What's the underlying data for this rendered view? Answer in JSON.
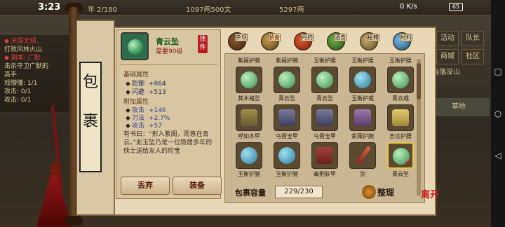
{
  "status_bar": {
    "time": "3:23",
    "net_speed": "0 K/s",
    "battery": "65"
  },
  "top_bar": {
    "date_text": "年 2/180",
    "money_text": "1097两500文",
    "gold_text": "5297两"
  },
  "background_left": {
    "lines": [
      "◆ 天涯无短,",
      "打败风林火山",
      "◆ 副本: 广默",
      "击杀守卫广默的",
      "高手",
      "戏懵懂: 1/1",
      "攻击: 0/1",
      "攻击: 0/1"
    ]
  },
  "background_right": {
    "buttons": [
      "活动",
      "队长",
      "商城",
      "社区"
    ],
    "stage": "洛落深山",
    "land": "草地"
  },
  "side_title": [
    "包",
    "裹"
  ],
  "item_detail": {
    "name": "青云坠",
    "requirement": "需要90级",
    "hang_label": "挂件",
    "base_header": "基础属性",
    "base_attrs": [
      {
        "name": "防御",
        "value": "+864"
      },
      {
        "name": "闪避",
        "value": "+513"
      }
    ],
    "extra_header": "附加属性",
    "extra_attrs": [
      {
        "name": "攻击",
        "value": "+146"
      },
      {
        "name": "刀法",
        "value": "+2.7%"
      },
      {
        "name": "攻击",
        "value": "+57"
      }
    ],
    "quote": "有书曰：“形入紫阁，而意在青云。”此玉坠乃是一位隐居多年的侠士送给友人的珍宝",
    "discard_label": "丢弃",
    "equip_label": "装备"
  },
  "categories": [
    {
      "label": "杂项",
      "icon": "misc-icon",
      "active": false
    },
    {
      "label": "装备",
      "icon": "equipment-icon",
      "active": true
    },
    {
      "label": "丹药",
      "icon": "pill-icon",
      "active": false
    },
    {
      "label": "酒食",
      "icon": "food-icon",
      "active": false
    },
    {
      "label": "秘籍",
      "icon": "manual-icon",
      "active": false
    },
    {
      "label": "材料",
      "icon": "material-icon",
      "active": false
    }
  ],
  "grid_rows": [
    {
      "top_labels": [
        "紫薇护腕",
        "紫薇护腕",
        "玉衡护腰",
        "玉衡护腰",
        "玉衡护腰"
      ]
    },
    {
      "items": [
        {
          "name": "其木格坠",
          "color": "#3c8c52"
        },
        {
          "name": "青云坠",
          "color": "#3c8c52"
        },
        {
          "name": "青云坠",
          "color": "#3c8c52"
        },
        {
          "name": "玉衡护戒",
          "color": "#2f7aa0"
        },
        {
          "name": "青云戒",
          "color": "#3c8c52"
        }
      ]
    },
    {
      "items": [
        {
          "name": "呼如木甲",
          "color": "#6a5a34"
        },
        {
          "name": "乌晋宝甲",
          "color": "#3c3c5a"
        },
        {
          "name": "乌晋宝甲",
          "color": "#3c3c5a"
        },
        {
          "name": "紫薇护腕",
          "color": "#5a3c6a"
        },
        {
          "name": "吉达护腰",
          "color": "#a08a3a"
        }
      ]
    },
    {
      "items": [
        {
          "name": "玉衡护腕",
          "color": "#2f7aa0"
        },
        {
          "name": "玉衡护腕",
          "color": "#2f7aa0"
        },
        {
          "name": "毒荆软甲",
          "color": "#6a2020"
        },
        {
          "name": "剑",
          "color": "#8c2a1a"
        },
        {
          "name": "青云坠",
          "color": "#3c8c52"
        }
      ]
    }
  ],
  "capacity": {
    "label": "包裹容量",
    "value": "229/230"
  },
  "sort_label": "整理",
  "leave_label": "离开"
}
